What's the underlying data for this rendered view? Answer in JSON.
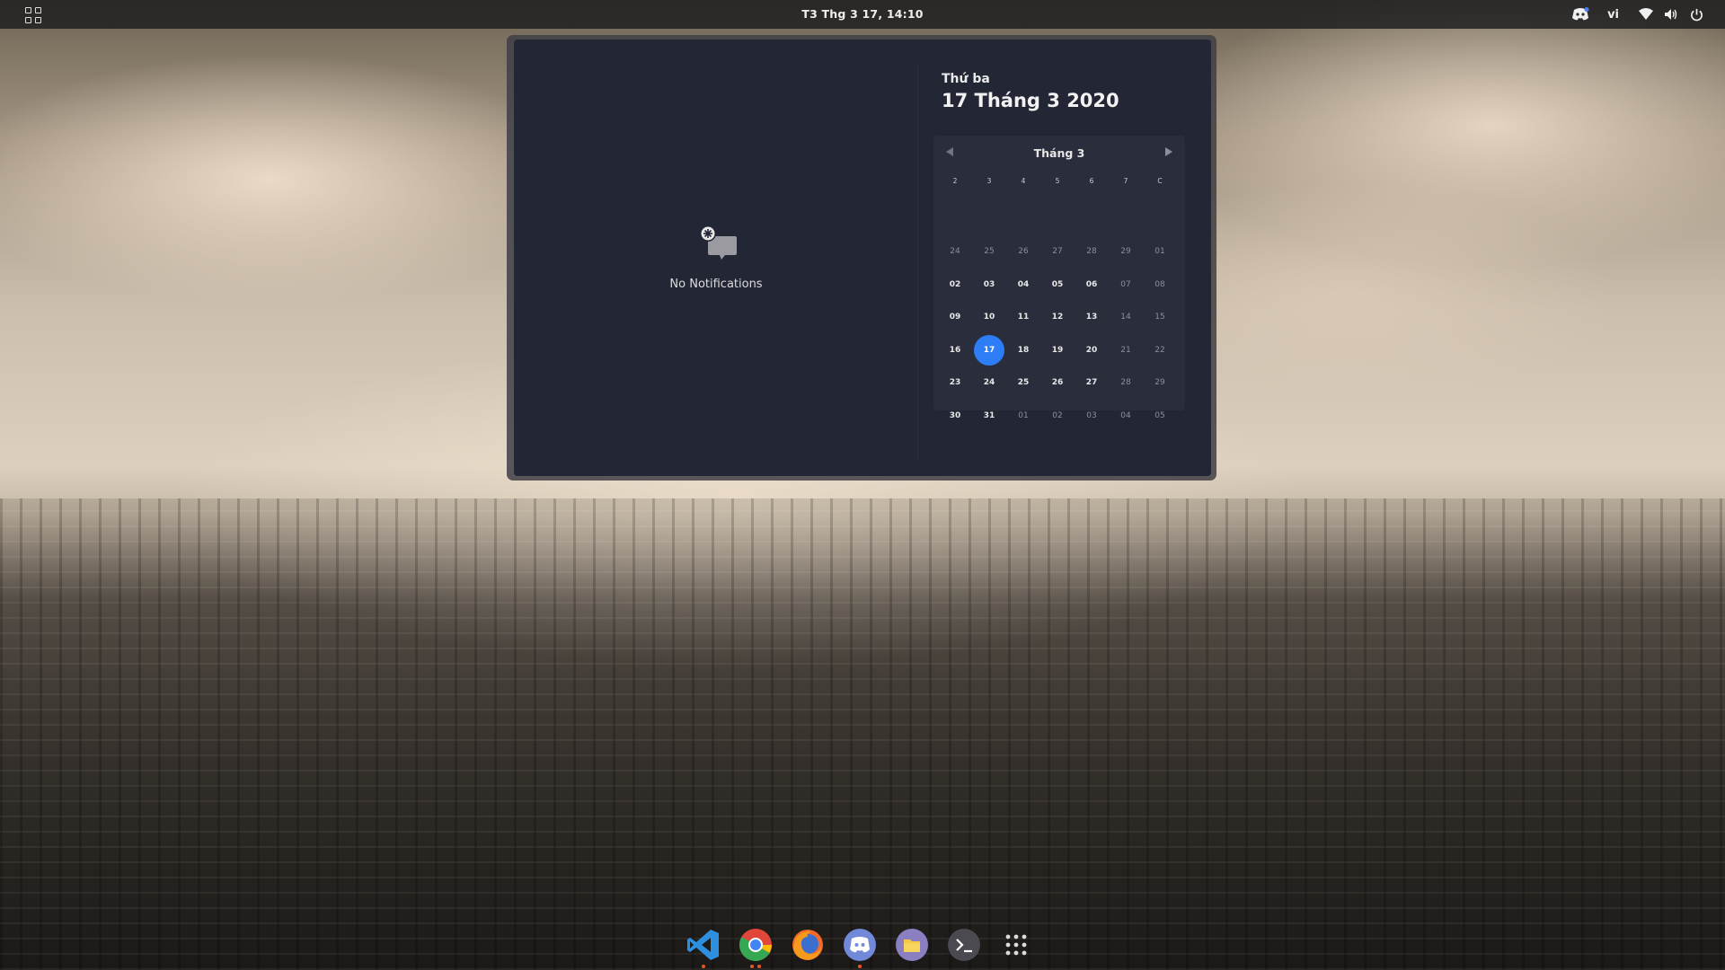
{
  "topbar": {
    "clock": "T3 Thg 3 17, 14:10",
    "language": "vi",
    "icons": [
      "activities-grid-icon",
      "discord-tray-icon",
      "wifi-icon",
      "volume-icon",
      "power-icon"
    ]
  },
  "notifications": {
    "empty_label": "No Notifications",
    "icon": "no-notifications-icon"
  },
  "date": {
    "weekday": "Thứ ba",
    "full": "17 Tháng 3 2020"
  },
  "calendar": {
    "month_label": "Tháng 3",
    "weekdays": [
      "2",
      "3",
      "4",
      "5",
      "6",
      "7",
      "C"
    ],
    "weeks": [
      [
        "24",
        "25",
        "26",
        "27",
        "28",
        "29",
        "01"
      ],
      [
        "02",
        "03",
        "04",
        "05",
        "06",
        "07",
        "08"
      ],
      [
        "09",
        "10",
        "11",
        "12",
        "13",
        "14",
        "15"
      ],
      [
        "16",
        "17",
        "18",
        "19",
        "20",
        "21",
        "22"
      ],
      [
        "23",
        "24",
        "25",
        "26",
        "27",
        "28",
        "29"
      ],
      [
        "30",
        "31",
        "01",
        "02",
        "03",
        "04",
        "05"
      ]
    ],
    "selected": "17",
    "accent": "#2d7df6"
  },
  "dock": {
    "apps": [
      "vscode-icon",
      "chrome-icon",
      "firefox-icon",
      "discord-icon",
      "files-icon",
      "terminal-icon",
      "show-applications-icon"
    ],
    "running_indicator": "#e95420"
  }
}
